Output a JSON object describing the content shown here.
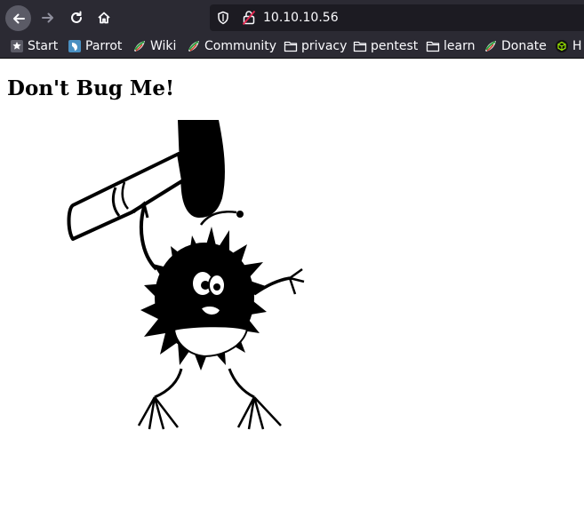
{
  "browser": {
    "url": "10.10.10.56",
    "nav": {
      "back": "back-arrow-icon",
      "forward": "forward-arrow-icon",
      "reload": "reload-icon",
      "home": "home-icon"
    },
    "bookmarks": [
      {
        "label": "Start",
        "icon": "star-icon"
      },
      {
        "label": "Parrot",
        "icon": "parrot-icon"
      },
      {
        "label": "Wiki",
        "icon": "parrot-leaf-icon"
      },
      {
        "label": "Community",
        "icon": "parrot-leaf-icon"
      },
      {
        "label": "privacy",
        "icon": "folder-icon"
      },
      {
        "label": "pentest",
        "icon": "folder-icon"
      },
      {
        "label": "learn",
        "icon": "folder-icon"
      },
      {
        "label": "Donate",
        "icon": "parrot-leaf-icon"
      },
      {
        "label": "H",
        "icon": "hackthebox-icon"
      }
    ]
  },
  "page": {
    "title": "Don't Bug Me!",
    "image": "bug-with-hammer-drawing"
  },
  "colors": {
    "toolbar": "#2b2a33",
    "urlbar": "#1c1b22",
    "text_light": "#fbfbfe",
    "page_bg": "#ffffff"
  }
}
